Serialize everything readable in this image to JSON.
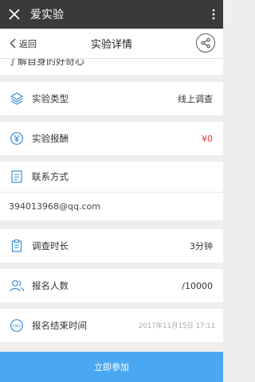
{
  "app": {
    "title": "爱实验"
  },
  "nav": {
    "back_label": "返回",
    "title": "实验详情"
  },
  "clipped_text": "了解自身的好奇心",
  "rows": {
    "type": {
      "label": "实验类型",
      "value": "线上调查"
    },
    "reward": {
      "label": "实验报酬",
      "value": "¥0"
    },
    "contact": {
      "label": "联系方式",
      "value": "394013968@qq.com"
    },
    "duration": {
      "label": "调查时长",
      "value": "3分钟"
    },
    "signup": {
      "label": "报名人数",
      "value": "/10000"
    },
    "deadline": {
      "label": "报名结束时间",
      "value": "2017年11月15日 17:11"
    }
  },
  "footer": {
    "button_label": "立即参加"
  },
  "colors": {
    "icon_blue": "#3c8fd8",
    "accent_red": "#e53935",
    "button_blue": "#4aa8f2",
    "titlebar": "#3a3a3a"
  }
}
